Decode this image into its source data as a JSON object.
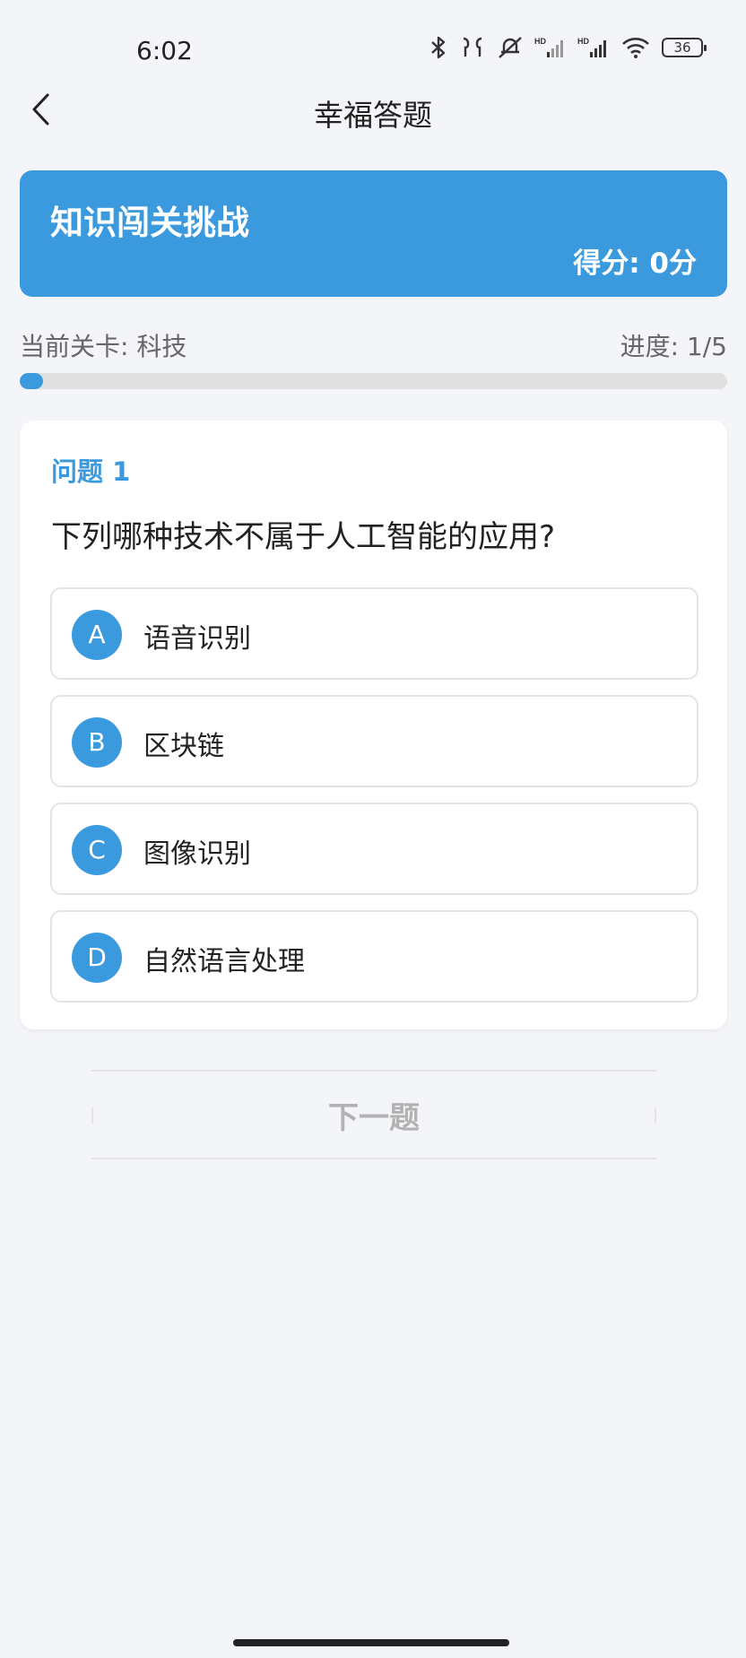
{
  "status_bar": {
    "time": "6:02",
    "battery": "36",
    "icons": [
      "bluetooth-icon",
      "earbuds-icon",
      "mute-icon",
      "hd-signal-icon",
      "hd-signal-icon",
      "wifi-icon",
      "battery-icon"
    ]
  },
  "header": {
    "title": "幸福答题",
    "back_icon": "chevron-left-icon"
  },
  "banner": {
    "title": "知识闯关挑战",
    "score": "得分: 0分",
    "color": "#3b9ade"
  },
  "progress": {
    "level_label": "当前关卡: 科技",
    "progress_label": "进度: 1/5",
    "fraction": 0.033
  },
  "question": {
    "number_label": "问题 1",
    "text": "下列哪种技术不属于人工智能的应用?",
    "options": [
      {
        "letter": "A",
        "text": "语音识别"
      },
      {
        "letter": "B",
        "text": "区块链"
      },
      {
        "letter": "C",
        "text": "图像识别"
      },
      {
        "letter": "D",
        "text": "自然语言处理"
      }
    ]
  },
  "next_button": {
    "label": "下一题"
  },
  "colors": {
    "accent": "#3b9ade",
    "background": "#f4f5f9",
    "disabled_text": "#b2b2b2"
  }
}
